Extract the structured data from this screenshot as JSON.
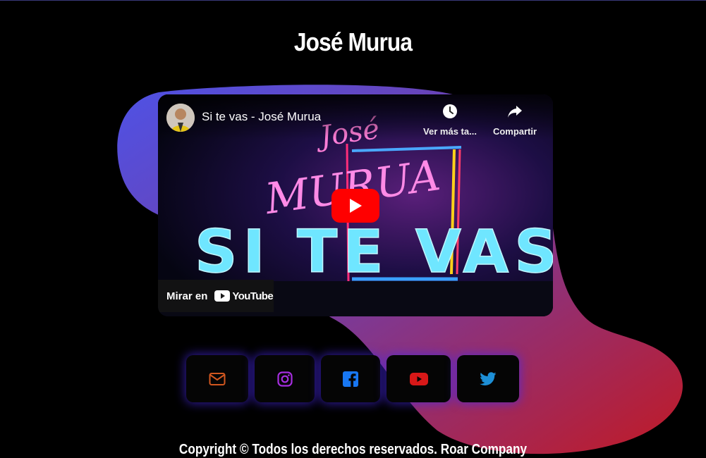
{
  "page": {
    "title": "José Murua"
  },
  "video": {
    "title": "Si te vas - José Murua",
    "watch_later_label": "Ver más ta...",
    "share_label": "Compartir",
    "watch_on_label": "Mirar en",
    "youtube_label": "YouTube",
    "thumbnail_text_top": "José",
    "thumbnail_text_mid": "MURUA",
    "thumbnail_text_main": "SI TE VAS"
  },
  "socials": [
    {
      "name": "email",
      "icon": "mail-icon",
      "color": "#d2571f"
    },
    {
      "name": "instagram",
      "icon": "instagram-icon",
      "color": "#a62ee0"
    },
    {
      "name": "facebook",
      "icon": "facebook-icon",
      "color": "#1877f2"
    },
    {
      "name": "youtube",
      "icon": "youtube-icon",
      "color": "#d81818"
    },
    {
      "name": "twitter",
      "icon": "twitter-icon",
      "color": "#1d8fd6"
    }
  ],
  "footer": {
    "copyright": "Copyright © Todos los derechos reservados. Roar Company"
  },
  "colors": {
    "blob_start": "#4f4fe0",
    "blob_end": "#b8182a",
    "play": "#ff0000"
  }
}
